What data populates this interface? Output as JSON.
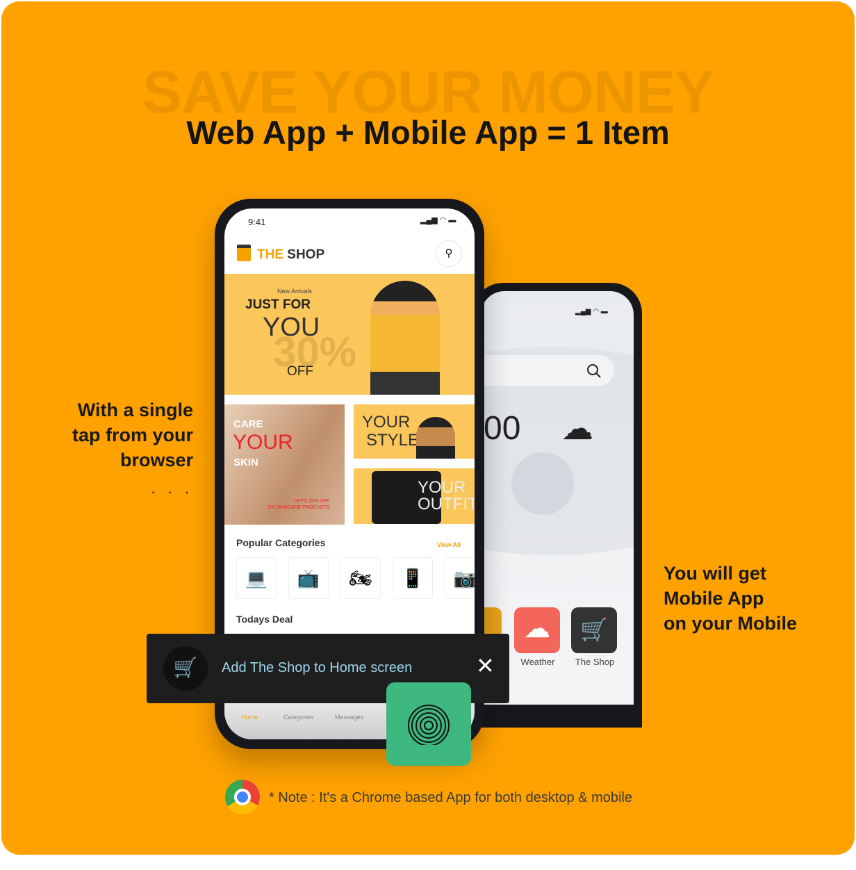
{
  "hero": {
    "watermark": "SAVE YOUR MONEY",
    "headline": "Web App + Mobile App = 1 Item"
  },
  "left_text": [
    "With a single",
    "tap from your",
    "browser"
  ],
  "left_dots": ". . .",
  "right_text": [
    "You will get",
    "Mobile App",
    "on your Mobile"
  ],
  "phone": {
    "time": "9:41",
    "brand_the": "THE",
    "brand_shop": " SHOP",
    "banner": {
      "small": "New Arrivals",
      "title": "JUST FOR",
      "you": "YOU",
      "percent": "30%",
      "off": "OFF"
    },
    "care": {
      "l1": "CARE",
      "l2": "YOUR",
      "l3": "SKIN",
      "promo1": "UPTO 20% OFF",
      "promo2": "ON SKINCARE PRODUCTS"
    },
    "style": {
      "l1": "YOUR",
      "l2": "STYLE"
    },
    "outfit": {
      "l1": "YOUR",
      "l2": "OUTFIT"
    },
    "popular": "Popular Categories",
    "view_all": "View All",
    "categories": [
      "laptop",
      "tv",
      "motorbike",
      "phone",
      "camera"
    ],
    "todays_deal": "Todays Deal",
    "nav": [
      "Home",
      "Categories",
      "Messages"
    ]
  },
  "back_phone": {
    "temp": "00",
    "apps": [
      "Weather",
      "The Shop"
    ]
  },
  "toast": {
    "text": "Add The Shop to Home screen"
  },
  "note": "* Note : It's a Chrome based App for both desktop & mobile",
  "colors": {
    "background": "#FFA200",
    "accent": "#F5A100",
    "toast": "#1e1e1e",
    "fingerprint": "#3FB880",
    "weather": "#F4665A"
  }
}
